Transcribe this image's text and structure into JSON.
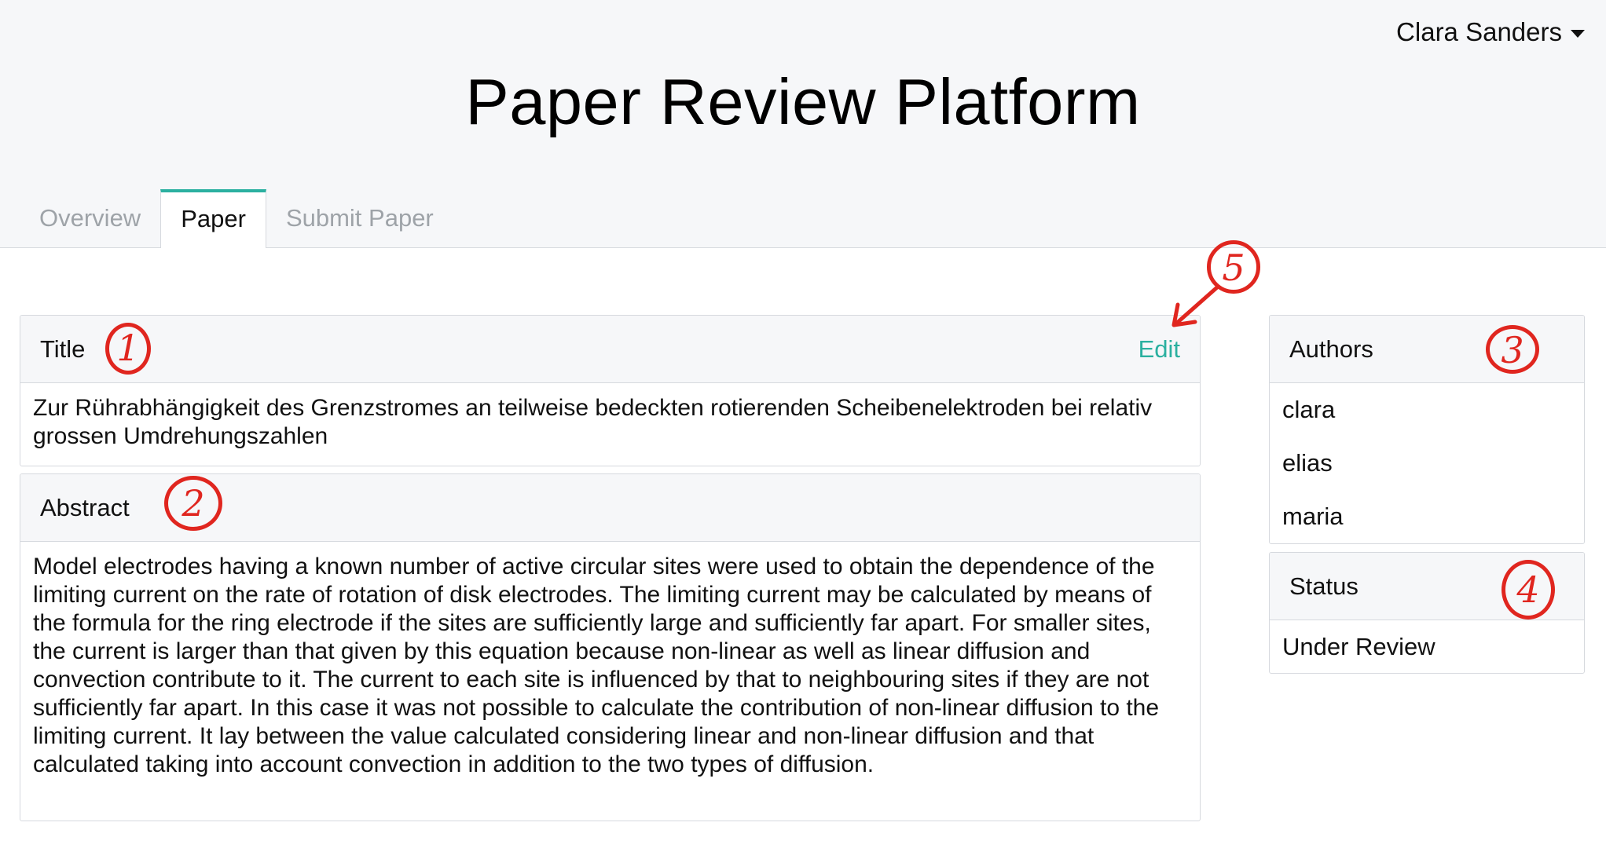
{
  "header": {
    "app_title": "Paper Review Platform",
    "user_name": "Clara Sanders",
    "user_menu_icon": "caret-down-icon"
  },
  "tabs": [
    {
      "label": "Overview",
      "active": false
    },
    {
      "label": "Paper",
      "active": true
    },
    {
      "label": "Submit Paper",
      "active": false
    }
  ],
  "title_panel": {
    "heading": "Title",
    "edit_label": "Edit",
    "text": "Zur Rührabhängigkeit des Grenzstromes an teilweise bedeckten rotierenden Scheibenelektroden bei relativ grossen Umdrehungszahlen"
  },
  "abstract_panel": {
    "heading": "Abstract",
    "text": "Model electrodes having a known number of active circular sites were used to obtain the dependence of the limiting current on the rate of rotation of disk electrodes. The limiting current may be calculated by means of the formula for the ring electrode if the sites are sufficiently large and sufficiently far apart. For smaller sites, the current is larger than that given by this equation because non-linear as well as linear diffusion and convection contribute to it. The current to each site is influenced by that to neighbouring sites if they are not sufficiently far apart. In this case it was not possible to calculate the contribution of non-linear diffusion to the limiting current. It lay between the value calculated considering linear and non-linear diffusion and that calculated taking into account convection in addition to the two types of diffusion."
  },
  "authors_panel": {
    "heading": "Authors",
    "items": [
      "clara",
      "elias",
      "maria"
    ]
  },
  "status_panel": {
    "heading": "Status",
    "value": "Under Review"
  },
  "annotations": [
    "1",
    "2",
    "3",
    "4",
    "5"
  ],
  "colors": {
    "accent": "#2bb0a0",
    "annotation": "#e0261f",
    "header_bg": "#f6f7f9",
    "border": "#d6d9de"
  }
}
